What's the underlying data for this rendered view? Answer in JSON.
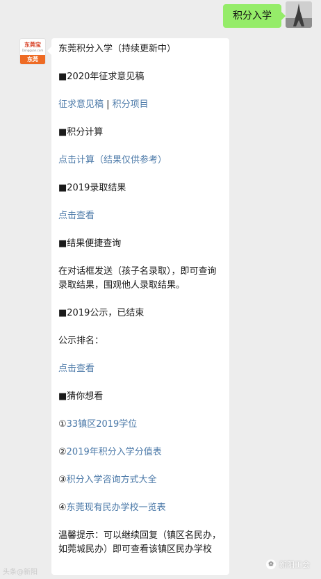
{
  "outgoing": {
    "text": "积分入学"
  },
  "bot": {
    "brand": "东莞宝",
    "brand_sub": "Dongguan.com",
    "city": "东莞"
  },
  "message": {
    "title": "东莞积分入学（持续更新中）",
    "s1_header": "■2020年征求意见稿",
    "s1_link1": "征求意见稿",
    "s1_sep": " | ",
    "s1_link2": "积分项目",
    "s2_header": "■积分计算",
    "s2_link": "点击计算（结果仅供参考）",
    "s3_header": "■2019录取结果",
    "s3_link": "点击查看",
    "s4_header": "■结果便捷查询",
    "s4_text": "在对话框发送（孩子名录取），即可查询录取结果，围观他人录取结果。",
    "s5_header": "■2019公示，已结束",
    "s5_text": "公示排名：",
    "s5_link": "点击查看",
    "s6_header": "■猜你想看",
    "items": [
      {
        "num": "①",
        "label": "33镇区2019学位"
      },
      {
        "num": "②",
        "label": "2019年积分入学分值表"
      },
      {
        "num": "③",
        "label": "积分入学咨询方式大全"
      },
      {
        "num": "④",
        "label": "东莞现有民办学校一览表"
      }
    ],
    "tip": "温馨提示：可以继续回复（镇区名民办，如莞城民办）即可查看该镇区民办学校"
  },
  "watermark": {
    "left": "头条@新阳",
    "right": "新阳工会"
  }
}
